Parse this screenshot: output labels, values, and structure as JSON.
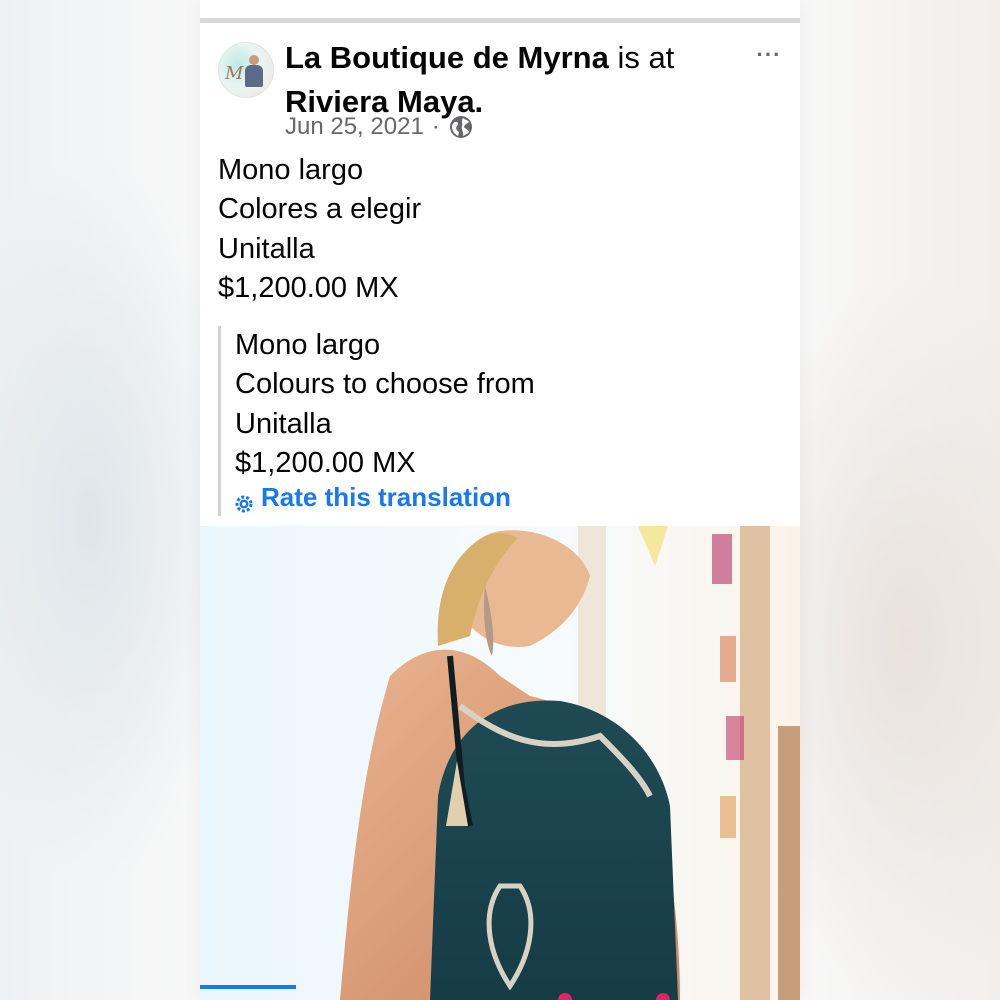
{
  "post": {
    "page_name": "La Boutique de Myrna",
    "action_text": "is at",
    "location": "Riviera Maya.",
    "date": "Jun 25, 2021",
    "separator": "·",
    "privacy_icon": "globe-icon",
    "more_icon": "more-options-icon",
    "more_label": "···",
    "avatar_monogram": "M",
    "original_text": [
      "Mono largo",
      "Colores a elegir",
      "Unitalla",
      "$1,200.00 MX"
    ],
    "translated_text": [
      "Mono largo",
      "Colours to choose from",
      "Unitalla",
      "$1,200.00 MX"
    ],
    "rate_translation_label": "Rate this translation",
    "rate_icon": "gear-icon",
    "photo_description_icon": "post-photo"
  },
  "colors": {
    "link_blue": "#1877f2",
    "text_primary": "#050505",
    "text_secondary": "#65676b",
    "divider": "#d6d8dc"
  }
}
